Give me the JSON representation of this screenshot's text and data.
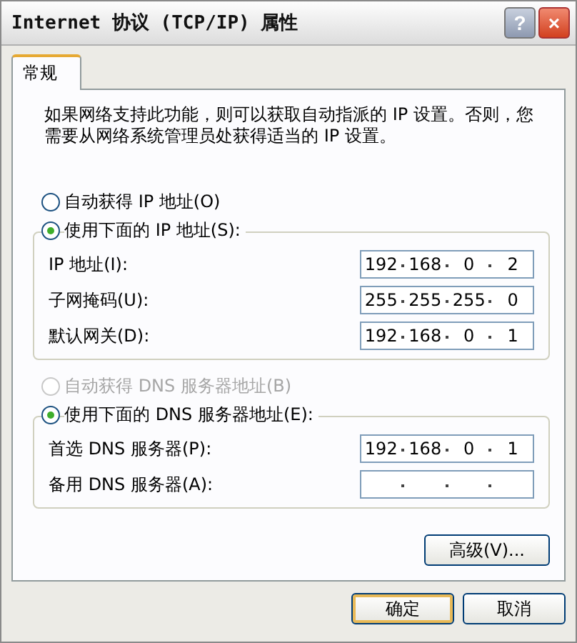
{
  "window": {
    "title": "Internet 协议 (TCP/IP) 属性",
    "buttons": [
      {
        "kind": "help",
        "label": "?"
      },
      {
        "kind": "close",
        "label": "×"
      }
    ]
  },
  "tabs": [
    {
      "label": "常规",
      "selected": true
    }
  ],
  "description": "如果网络支持此功能，则可以获取自动指派的 IP 设置。否则，您需要从网络系统管理员处获得适当的 IP 设置。",
  "sections": [
    {
      "auto": {
        "label": "自动获得 IP 地址(O)",
        "selected": false,
        "disabled": false
      },
      "manual": {
        "label": "使用下面的 IP 地址(S):",
        "selected": true,
        "fields": [
          {
            "label": "IP 地址(I):",
            "octets": [
              "192",
              "168",
              "0",
              "2"
            ]
          },
          {
            "label": "子网掩码(U):",
            "octets": [
              "255",
              "255",
              "255",
              "0"
            ]
          },
          {
            "label": "默认网关(D):",
            "octets": [
              "192",
              "168",
              "0",
              "1"
            ]
          }
        ]
      }
    },
    {
      "auto": {
        "label": "自动获得 DNS 服务器地址(B)",
        "selected": false,
        "disabled": true
      },
      "manual": {
        "label": "使用下面的 DNS 服务器地址(E):",
        "selected": true,
        "fields": [
          {
            "label": "首选 DNS 服务器(P):",
            "octets": [
              "192",
              "168",
              "0",
              "1"
            ]
          },
          {
            "label": "备用 DNS 服务器(A):"
          }
        ]
      }
    }
  ],
  "advanced_button": "高级(V)...",
  "footer_buttons": [
    {
      "label": "确定",
      "default": true
    },
    {
      "label": "取消",
      "default": false
    }
  ]
}
